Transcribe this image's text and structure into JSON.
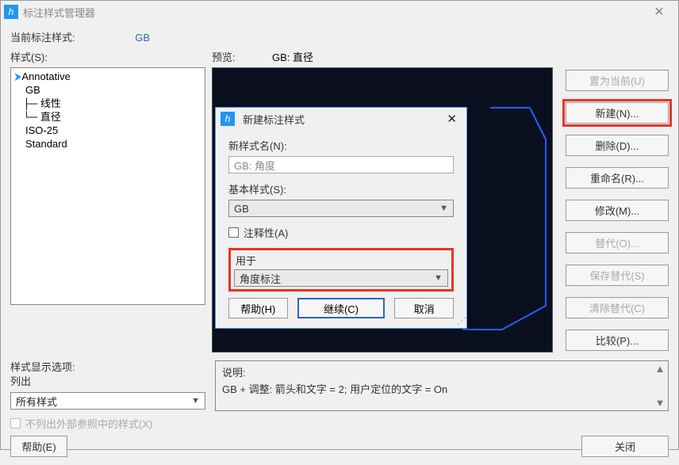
{
  "window": {
    "title": "标注样式管理器",
    "close_icon": "✕"
  },
  "current_style": {
    "label": "当前标注样式:",
    "value": "GB"
  },
  "styles": {
    "label": "样式(S):",
    "tree": {
      "annotative": "Annotative",
      "gb": "GB",
      "gb_linear": "线性",
      "gb_diameter": "直径",
      "iso25": "ISO-25",
      "standard": "Standard"
    }
  },
  "preview": {
    "label": "预览:",
    "value": "GB: 直径"
  },
  "buttons": {
    "set_current": "置为当前(U)",
    "new": "新建(N)...",
    "delete": "删除(D)...",
    "rename": "重命名(R)...",
    "modify": "修改(M)...",
    "override": "替代(O)...",
    "save_override": "保存替代(S)",
    "clear_override": "清除替代(C)",
    "compare": "比较(P)..."
  },
  "display_options": {
    "label1": "样式显示选项:",
    "label2": "列出",
    "combo_value": "所有样式",
    "checkbox_label": "不列出外部参照中的样式(X)"
  },
  "description": {
    "label": "说明:",
    "text": "GB + 调整: 箭头和文字 = 2; 用户定位的文字 = On"
  },
  "footer": {
    "help": "帮助(E)",
    "close": "关闭"
  },
  "modal": {
    "title": "新建标注样式",
    "new_name_label": "新样式名(N):",
    "new_name_value": "GB: 角度",
    "base_style_label": "基本样式(S):",
    "base_style_value": "GB",
    "annotative_label": "注释性(A)",
    "used_for_label": "用于",
    "used_for_value": "角度标注",
    "help": "帮助(H)",
    "continue": "继续(C)",
    "cancel": "取消"
  }
}
